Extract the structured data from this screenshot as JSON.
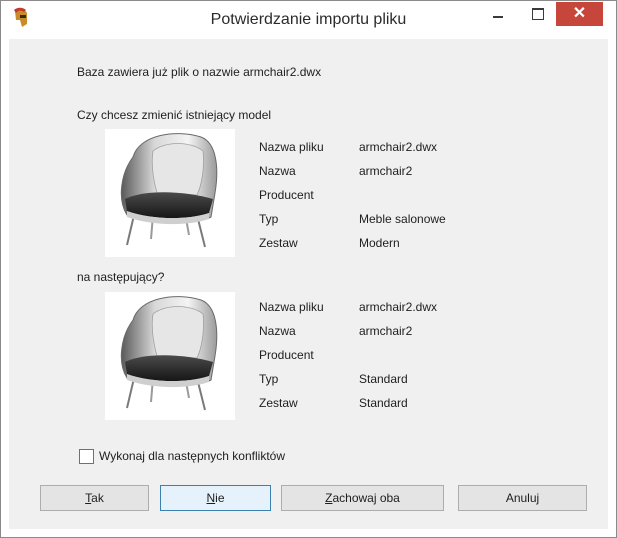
{
  "window": {
    "title": "Potwierdzanie importu pliku",
    "close_glyph": "✕",
    "app_icon": "spartan-helmet-icon"
  },
  "message": {
    "line1": "Baza zawiera już plik o nazwie armchair2.dwx",
    "line2": "Czy chcesz zmienić istniejący model",
    "line3": "na następujący?"
  },
  "existing": {
    "rows": [
      {
        "label": "Nazwa pliku",
        "value": "armchair2.dwx"
      },
      {
        "label": "Nazwa",
        "value": "armchair2"
      },
      {
        "label": "Producent",
        "value": ""
      },
      {
        "label": "Typ",
        "value": "Meble salonowe"
      },
      {
        "label": "Zestaw",
        "value": "Modern"
      }
    ]
  },
  "replacement": {
    "rows": [
      {
        "label": "Nazwa pliku",
        "value": "armchair2.dwx"
      },
      {
        "label": "Nazwa",
        "value": "armchair2"
      },
      {
        "label": "Producent",
        "value": ""
      },
      {
        "label": "Typ",
        "value": "Standard"
      },
      {
        "label": "Zestaw",
        "value": "Standard"
      }
    ]
  },
  "checkbox": {
    "label": "Wykonaj dla następnych konfliktów",
    "checked": false
  },
  "buttons": {
    "tak": {
      "first": "T",
      "rest": "ak"
    },
    "nie": {
      "first": "N",
      "rest": "ie"
    },
    "zachowaj": {
      "first": "Z",
      "rest": "achowaj oba"
    },
    "anuluj": "Anuluj"
  }
}
